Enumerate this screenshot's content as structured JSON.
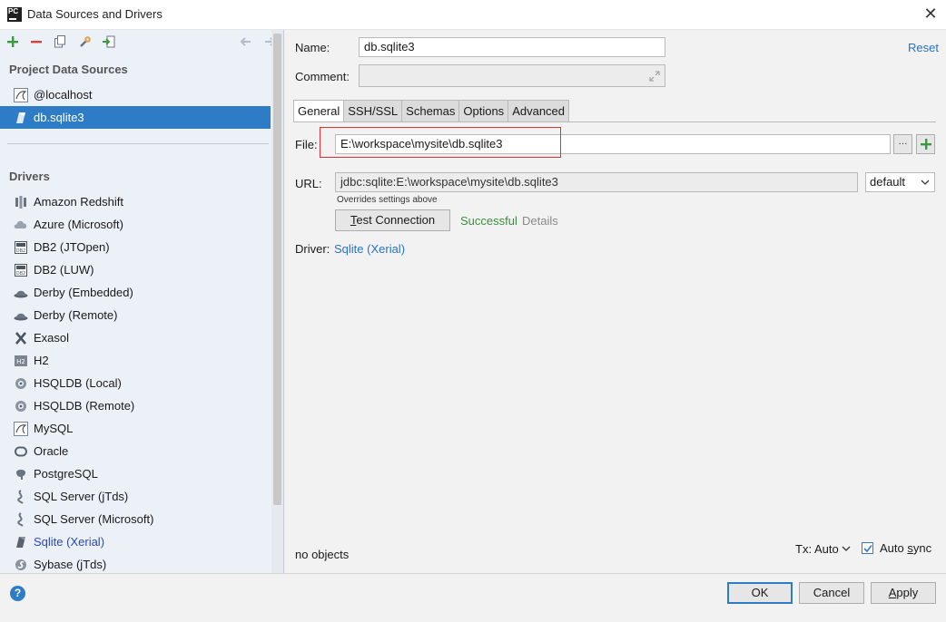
{
  "window": {
    "title": "Data Sources and Drivers",
    "app_icon_text": "PC",
    "close_glyph": "✕"
  },
  "toolbar": {
    "add_icon": "plus-icon",
    "remove_icon": "minus-icon",
    "duplicate_icon": "copy-icon",
    "properties_icon": "wrench-icon",
    "import_icon": "import-icon",
    "back_icon": "arrow-left-icon",
    "forward_icon": "arrow-right-icon"
  },
  "sidebar": {
    "project_title": "Project Data Sources",
    "project_items": [
      {
        "label": "@localhost",
        "icon": "mysql-icon"
      },
      {
        "label": "db.sqlite3",
        "icon": "sqlite-icon",
        "selected": true
      }
    ],
    "drivers_title": "Drivers",
    "drivers": [
      {
        "label": "Amazon Redshift",
        "icon": "redshift-icon"
      },
      {
        "label": "Azure (Microsoft)",
        "icon": "azure-icon"
      },
      {
        "label": "DB2 (JTOpen)",
        "icon": "db2-icon"
      },
      {
        "label": "DB2 (LUW)",
        "icon": "db2-icon"
      },
      {
        "label": "Derby (Embedded)",
        "icon": "derby-icon"
      },
      {
        "label": "Derby (Remote)",
        "icon": "derby-icon"
      },
      {
        "label": "Exasol",
        "icon": "exasol-icon"
      },
      {
        "label": "H2",
        "icon": "h2-icon"
      },
      {
        "label": "HSQLDB (Local)",
        "icon": "hsqldb-icon"
      },
      {
        "label": "HSQLDB (Remote)",
        "icon": "hsqldb-icon"
      },
      {
        "label": "MySQL",
        "icon": "mysql-icon"
      },
      {
        "label": "Oracle",
        "icon": "oracle-icon"
      },
      {
        "label": "PostgreSQL",
        "icon": "postgresql-icon"
      },
      {
        "label": "SQL Server (jTds)",
        "icon": "sqlserver-icon"
      },
      {
        "label": "SQL Server (Microsoft)",
        "icon": "sqlserver-icon"
      },
      {
        "label": "Sqlite (Xerial)",
        "icon": "sqlite-icon",
        "highlight": true
      },
      {
        "label": "Sybase (jTds)",
        "icon": "sybase-icon"
      }
    ]
  },
  "form": {
    "name_label": "Name:",
    "name_value": "db.sqlite3",
    "reset_label": "Reset",
    "comment_label": "Comment:",
    "comment_value": "",
    "tabs": [
      {
        "label": "General",
        "active": true
      },
      {
        "label": "SSH/SSL"
      },
      {
        "label": "Schemas"
      },
      {
        "label": "Options"
      },
      {
        "label": "Advanced"
      }
    ],
    "file_label": "File:",
    "file_value": "E:\\workspace\\mysite\\db.sqlite3",
    "browse_label": "···",
    "add_icon": "plus-icon",
    "url_label": "URL:",
    "url_value": "jdbc:sqlite:E:\\workspace\\mysite\\db.sqlite3",
    "url_mode": "default",
    "overrides_note": "Overrides settings above",
    "test_connection_label": "Test Connection",
    "test_status": "Successful",
    "details_label": "Details",
    "driver_label": "Driver:",
    "driver_value": "Sqlite (Xerial)",
    "no_objects": "no objects",
    "tx_label": "Tx: Auto",
    "auto_sync_label": "Auto sync",
    "auto_sync_checked": true
  },
  "footer": {
    "help_glyph": "?",
    "ok_label": "OK",
    "cancel_label": "Cancel",
    "apply_label": "Apply"
  },
  "colors": {
    "selection": "#2f7cc6",
    "link": "#2773c5",
    "success": "#3b8f3b",
    "highlight_box": "#e03030"
  }
}
